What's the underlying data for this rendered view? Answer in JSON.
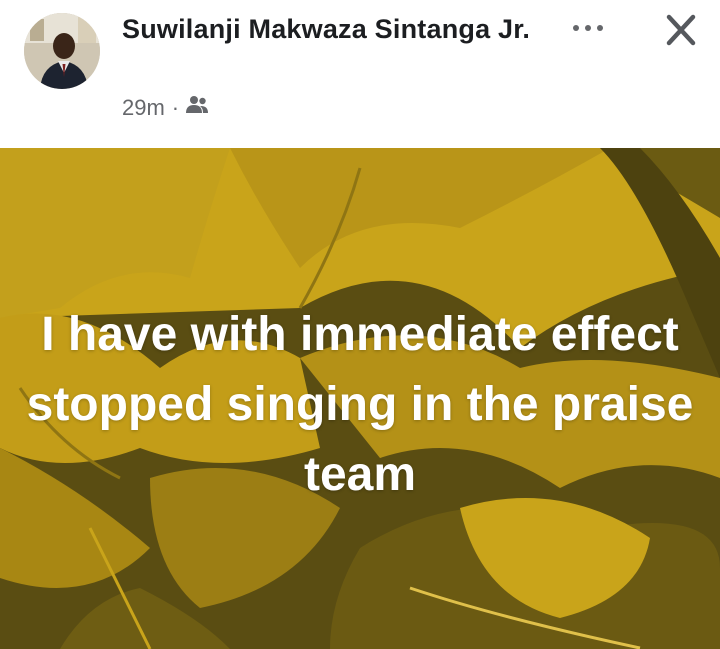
{
  "post": {
    "author_name": "Suwilanji Makwaza Sintanga Jr.",
    "time": "29m",
    "separator": "·",
    "audience_icon": "friends-icon",
    "more_icon": "more-horizontal-icon",
    "close_icon": "close-icon",
    "text": "I have with immediate effect stopped singing in the praise team"
  },
  "colors": {
    "background_gold": "#c9a41a",
    "background_dark": "#5a4d12",
    "text_dark": "#1c1e21",
    "text_meta": "#65676b"
  }
}
